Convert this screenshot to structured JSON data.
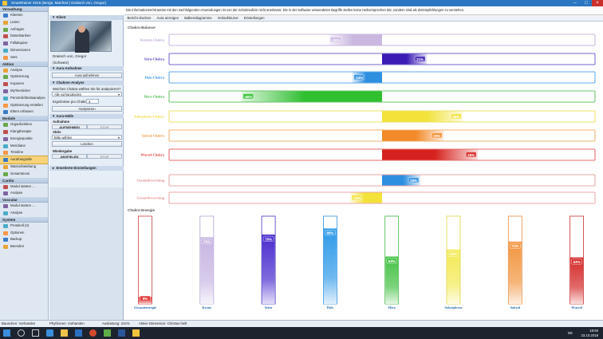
{
  "window": {
    "title": "SmartRainer 2016 (Bergs, Manfred | Draksch von, Gregor)"
  },
  "infobar": {
    "text": "Die Informationen/Hinweise mit den nachfolgenden Anwendungen ist von der Schulmedizin nicht anerkannt. Die in der Software verwendeten Begriffe stellen keine Heilversprechen dar, sondern sind als Zielempfehlungen zu verstehen."
  },
  "toolbar": {
    "items": [
      "Bericht drucken",
      "Aura anzeigen",
      "Balkendiagramme",
      "Verlaufskurve",
      "Einstellungen"
    ]
  },
  "nav": {
    "sections": [
      {
        "title": "Verwaltung",
        "items": [
          "Klienten",
          "Listen",
          "Anfragen",
          "Datenbanken",
          "Fallakquise",
          "Dimensionen",
          "Sets"
        ]
      },
      {
        "title": "Aktion",
        "items": [
          "Analyse",
          "Optimierung",
          "Kopieren",
          "MyTeesticker",
          "Persönlichkeitsanalyse",
          "Optimierung erstellen",
          "Eltern erfassen"
        ]
      },
      {
        "title": "Module",
        "items": [
          "Organfunktion",
          "Klangtherapie",
          "Energiepunkte",
          "Meridiane",
          "Timeline",
          "Aurafotografie",
          "Wasserbelebung",
          "Gesamtscan"
        ]
      },
      {
        "title": "Cardio",
        "items": [
          "Modul starten ...",
          "Analyse"
        ]
      },
      {
        "title": "Vascular",
        "items": [
          "Modul starten ...",
          "Analyse"
        ]
      },
      {
        "title": "System",
        "items": [
          "Protokoll (4)",
          "Optionen",
          "Backup",
          "Beenden"
        ]
      }
    ],
    "selected": "Aurafotografie"
  },
  "mid": {
    "klient_header": "Klient",
    "klient_name": "Draksch von, Gregor",
    "klient_country": "(Schweiz)",
    "aura_header": "Aura-Aufnahme",
    "aura_button": "Aura aufnehmen",
    "chakren_header": "Chakren-Analyse",
    "chakren_question": "Welches Chakra wählen Sie für analysieren?",
    "chakren_select": "Alle vorhandenden",
    "ergebnisse_label": "Ergebnisse pro Chakra:",
    "ergebnisse_value": "3",
    "analyse_button": "Analysieren",
    "aurahuelle_header": "Aura-Hülle",
    "aufnahme_label": "Aufnahme",
    "aufnehmen_btn": "AUFNEHMEN",
    "stop_btn": "STOP",
    "aktiv_label": "Aktiv",
    "bitte_select": "Bitte wählen",
    "loeschen_btn": "Löschen",
    "wiedergabe_label": "Wiedergabe",
    "abspielen_btn": "ABSPIELEN",
    "stop2_btn": "STOP",
    "erweitert": "Erweiterte Einstellungen"
  },
  "main": {
    "section1": "Chakra-Balance",
    "section2": "Chakra-Energie"
  },
  "colors": {
    "accent": "#2c77c2",
    "nav_bg": "#dfe8f2",
    "selected": "#f6d37a"
  },
  "chart_data": [
    {
      "type": "bar",
      "title": "Chakra-Balance",
      "categories": [
        "Kronen-Chakra",
        "Stirn-Chakra",
        "Hals-Chakra",
        "Herz-Chakra",
        "Solarplexus-Chakra",
        "Sakral-Chakra",
        "Wurzel-Chakra",
        "Gesamtbewertung",
        "Gesamtbewertung"
      ],
      "values": [
        -25,
        21,
        -14,
        -66,
        38,
        29,
        45,
        18,
        -15
      ],
      "labels": [
        "-25%",
        "21%",
        "-14%",
        "-66%",
        "38%",
        "29%",
        "45%",
        "18%",
        "-15%"
      ],
      "colors": [
        "#cbb8e0",
        "#3b1cb5",
        "#2e8fe0",
        "#2fbf2f",
        "#f2e23a",
        "#f28a2a",
        "#d6221e",
        "#2e8fe0",
        "#f2e23a"
      ],
      "borders": [
        "#b9a0d4",
        "#4a3ac0",
        "#2e8fe0",
        "#3ab33a",
        "#e8d834",
        "#f0963e",
        "#dc3b3b",
        "#e08a8a",
        "#e88f8f"
      ],
      "xlim": [
        -100,
        100
      ]
    },
    {
      "type": "bar",
      "title": "Chakra-Energie",
      "categories": [
        "Gesamtenergie",
        "Krone",
        "Stirn",
        "Hals",
        "Herz",
        "Solarplexus",
        "Sakral",
        "Wurzel"
      ],
      "values": [
        8,
        76,
        79,
        86,
        54,
        62,
        71,
        53
      ],
      "labels": [
        "8%",
        "76%",
        "79%",
        "86%",
        "54%",
        "62%",
        "71%",
        "53%"
      ],
      "colors": [
        "#e33a3a",
        "#c7b5e2",
        "#4a2ccf",
        "#2e9ae8",
        "#45c245",
        "#f3ea55",
        "#f29540",
        "#d52a2a"
      ],
      "borders": [
        "#d04040",
        "#b6a2d8",
        "#4632c0",
        "#2e8fe0",
        "#40b540",
        "#e0d640",
        "#e38a3e",
        "#c83030"
      ],
      "ylim": [
        0,
        100
      ]
    }
  ],
  "status": {
    "s1": "Bauschen: Vorhanden",
    "s2": "Phythonen: Vorhanden",
    "s3": "Auslastung: 244%",
    "s4": "Aktive Dimension: Christus heilt"
  },
  "taskbar": {
    "lang": "DE",
    "time": "18:50",
    "date": "23.10.2018"
  }
}
